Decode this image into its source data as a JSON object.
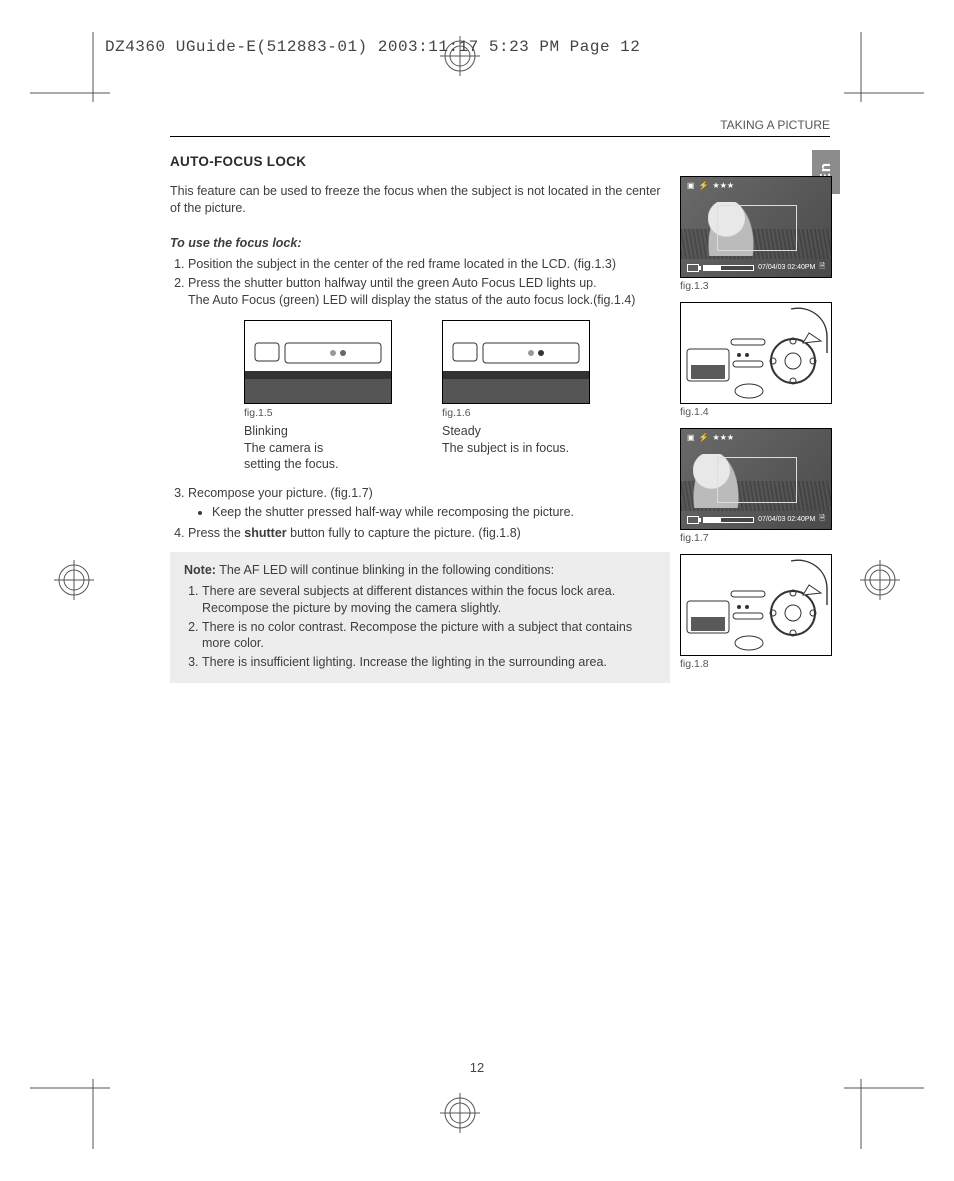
{
  "slug": "DZ4360 UGuide-E(512883-01)  2003:11:17  5:23 PM  Page 12",
  "running_head": "TAKING A PICTURE",
  "lang_tab": "En",
  "section_title": "AUTO-FOCUS LOCK",
  "intro": "This feature can be used to freeze the focus when the subject is not located in the center of the picture.",
  "subhead": "To use the focus lock:",
  "steps_a": {
    "s1": "Position the subject in the center of the red frame located in the LCD. (fig.1.3)",
    "s2a": "Press the shutter button halfway until the green Auto Focus LED lights up.",
    "s2b": "The Auto Focus (green) LED will display the status of the auto focus lock.(fig.1.4)"
  },
  "midfig": {
    "left": {
      "cap": "fig.1.5",
      "l1": "Blinking",
      "l2": "The camera is",
      "l3": "setting the focus."
    },
    "right": {
      "cap": "fig.1.6",
      "l1": "Steady",
      "l2": "The subject is in focus."
    }
  },
  "steps_b": {
    "s3": "Recompose your picture. (fig.1.7)",
    "s3sub": "Keep the shutter pressed half-way while recomposing the picture.",
    "s4a": "Press the ",
    "s4b": "shutter",
    "s4c": " button fully to capture the picture. (fig.1.8)"
  },
  "note": {
    "lead_b": "Note:",
    "lead": " The AF LED will continue blinking in the following conditions:",
    "n1": "There are several subjects at different distances within the focus lock area. Recompose the picture by moving the camera slightly.",
    "n2": "There is no color contrast. Recompose the picture with a subject that contains more color.",
    "n3": "There is insufficient lighting. Increase the lighting in the surrounding area."
  },
  "rfigs": {
    "f13": "fig.1.3",
    "f14": "fig.1.4",
    "f17": "fig.1.7",
    "f18": "fig.1.8"
  },
  "lcd": {
    "stars": "★★★",
    "timestamp": "07/04/03  02:40PM"
  },
  "page_number": "12"
}
